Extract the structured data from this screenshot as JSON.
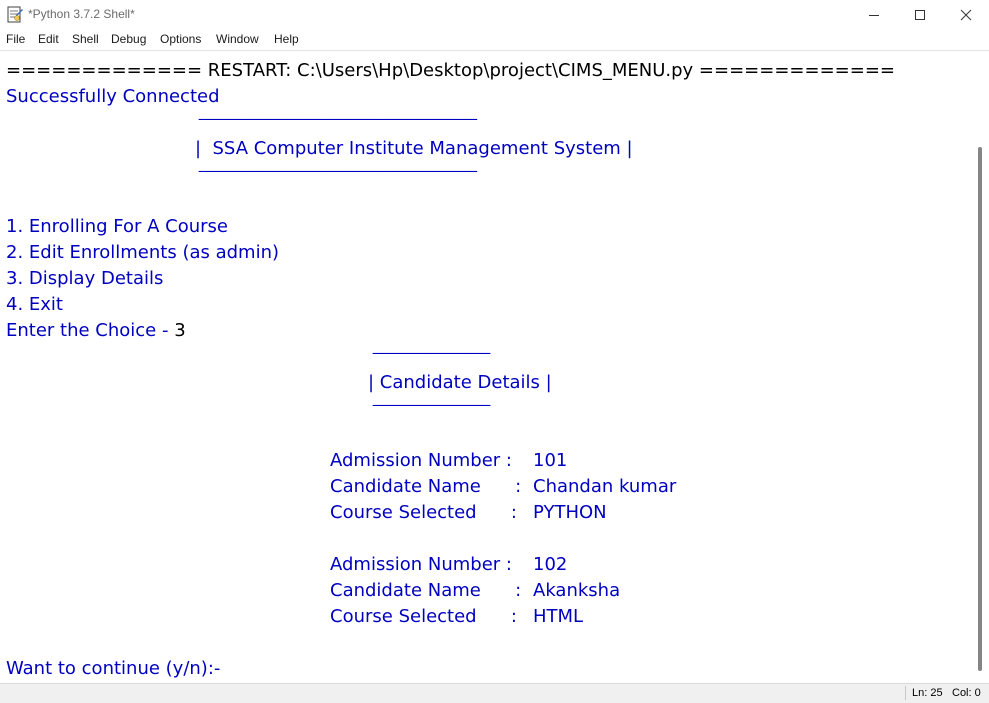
{
  "window": {
    "title": "*Python 3.7.2 Shell*"
  },
  "menu": [
    "File",
    "Edit",
    "Shell",
    "Debug",
    "Options",
    "Window",
    "Help"
  ],
  "shell": {
    "restart_line": "============= RESTART: C:\\Users\\Hp\\Desktop\\project\\CIMS_MENU.py =============",
    "connected": "Successfully Connected",
    "header_rule": "------------------------------------------------------------------------------------------",
    "header_title": "|  SSA Computer Institute Management System |",
    "menu_options": [
      "1. Enrolling For A Course",
      "2. Edit Enrollments (as admin)",
      "3. Display Details",
      "4. Exit"
    ],
    "choice_prompt": "Enter the Choice - ",
    "choice_value": "3",
    "details_rule": "--------------------------------------",
    "details_title": "| Candidate Details |",
    "records": [
      {
        "adm_label": "Admission Number :  ",
        "adm_value": "101",
        "name_label": "Candidate Name      :  ",
        "name_value": "Chandan kumar",
        "course_label": "Course Selected      :  ",
        "course_value": "PYTHON"
      },
      {
        "adm_label": "Admission Number :  ",
        "adm_value": "102",
        "name_label": "Candidate Name      :  ",
        "name_value": "Akanksha",
        "course_label": "Course Selected      :  ",
        "course_value": "HTML"
      }
    ],
    "continue_prompt": "Want to continue (y/n):-"
  },
  "status": {
    "line": "Ln: 25",
    "col": "Col: 0"
  },
  "icons": {
    "app": "python-idle-icon",
    "minimize": "minimize-icon",
    "maximize": "maximize-icon",
    "close": "close-icon"
  },
  "colors": {
    "output_text": "#0000c0",
    "input_text": "#000000"
  }
}
